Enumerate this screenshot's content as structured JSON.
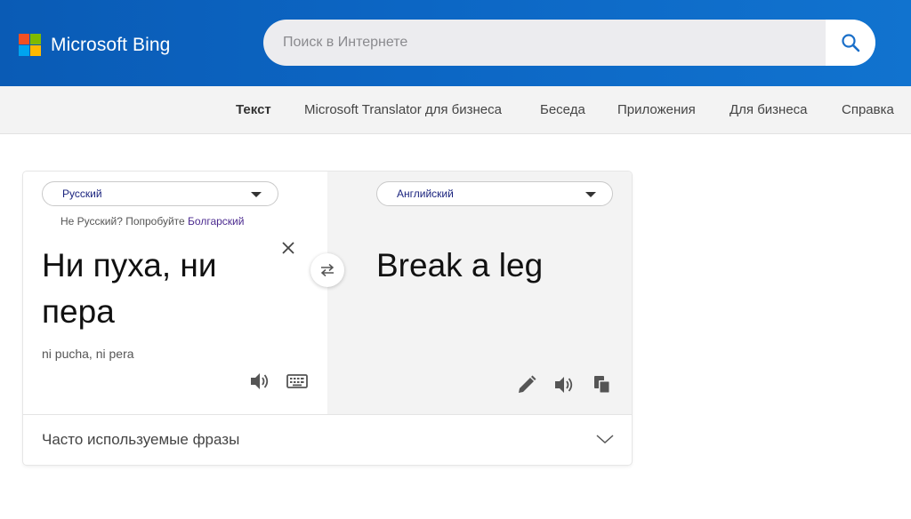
{
  "header": {
    "brand": "Microsoft Bing",
    "logo_icon": "microsoft-logo-icon",
    "search": {
      "placeholder": "Поиск в Интернете",
      "value": "",
      "button_icon": "search-icon"
    }
  },
  "nav": {
    "items": [
      {
        "label": "Текст",
        "active": true
      },
      {
        "label": "Microsoft Translator для бизнеса",
        "active": false
      },
      {
        "label": "Беседа",
        "active": false
      },
      {
        "label": "Приложения",
        "active": false
      },
      {
        "label": "Для бизнеса",
        "active": false
      },
      {
        "label": "Справка",
        "active": false
      }
    ]
  },
  "translator": {
    "source": {
      "language": "Русский",
      "detect_hint": "Не Русский? Попробуйте",
      "detect_suggestion": "Болгарский",
      "text": "Ни пуха, ни пера",
      "transliteration": "ni pucha, ni pera",
      "icons": [
        "close-icon",
        "speaker-icon",
        "keyboard-icon"
      ]
    },
    "target": {
      "language": "Английский",
      "text": "Break a leg",
      "icons": [
        "pencil-icon",
        "speaker-icon",
        "copy-icon"
      ]
    },
    "swap_icon": "swap-arrows-icon",
    "phrases_label": "Часто используемые фразы"
  },
  "colors": {
    "header_blue": "#0c66c4",
    "link_purple": "#4b2a8f",
    "language_text": "#1a237e",
    "icon_gray": "#555555"
  }
}
